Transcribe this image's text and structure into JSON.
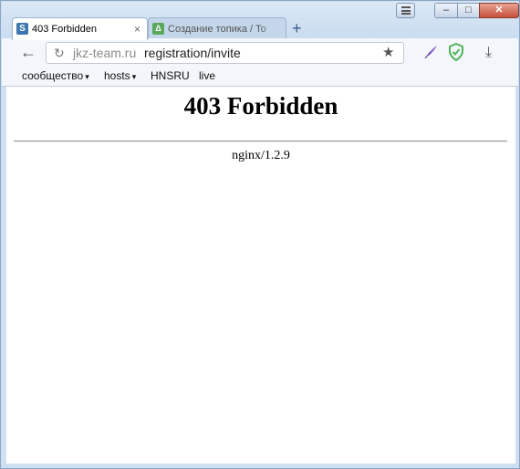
{
  "tabs": [
    {
      "favicon": "S",
      "title": "403 Forbidden",
      "close": "×"
    },
    {
      "favicon": "Δ",
      "title": "Создание топика / To"
    }
  ],
  "new_tab": "+",
  "window": {
    "minimize": "‒",
    "maximize": "□",
    "close": "✕"
  },
  "toolbar": {
    "back": "←",
    "reload": "↻",
    "domain": "jkz-team.ru",
    "path": "registration/invite",
    "star": "★",
    "download": "⤓"
  },
  "bookmarks": [
    {
      "label": "сообщество",
      "arrow": "▾"
    },
    {
      "label": "hosts",
      "arrow": "▾"
    },
    {
      "label": "HNSRU"
    },
    {
      "label": "live"
    }
  ],
  "page": {
    "heading": "403 Forbidden",
    "server": "nginx/1.2.9"
  },
  "colors": {
    "shield": "#53b45a",
    "feather": "#8d5fd3",
    "close": "#c7503a"
  },
  "icons": [
    "menu-icon",
    "back-arrow-icon",
    "reload-icon",
    "star-icon",
    "feather-icon",
    "shield-icon",
    "download-icon",
    "close-icon"
  ]
}
